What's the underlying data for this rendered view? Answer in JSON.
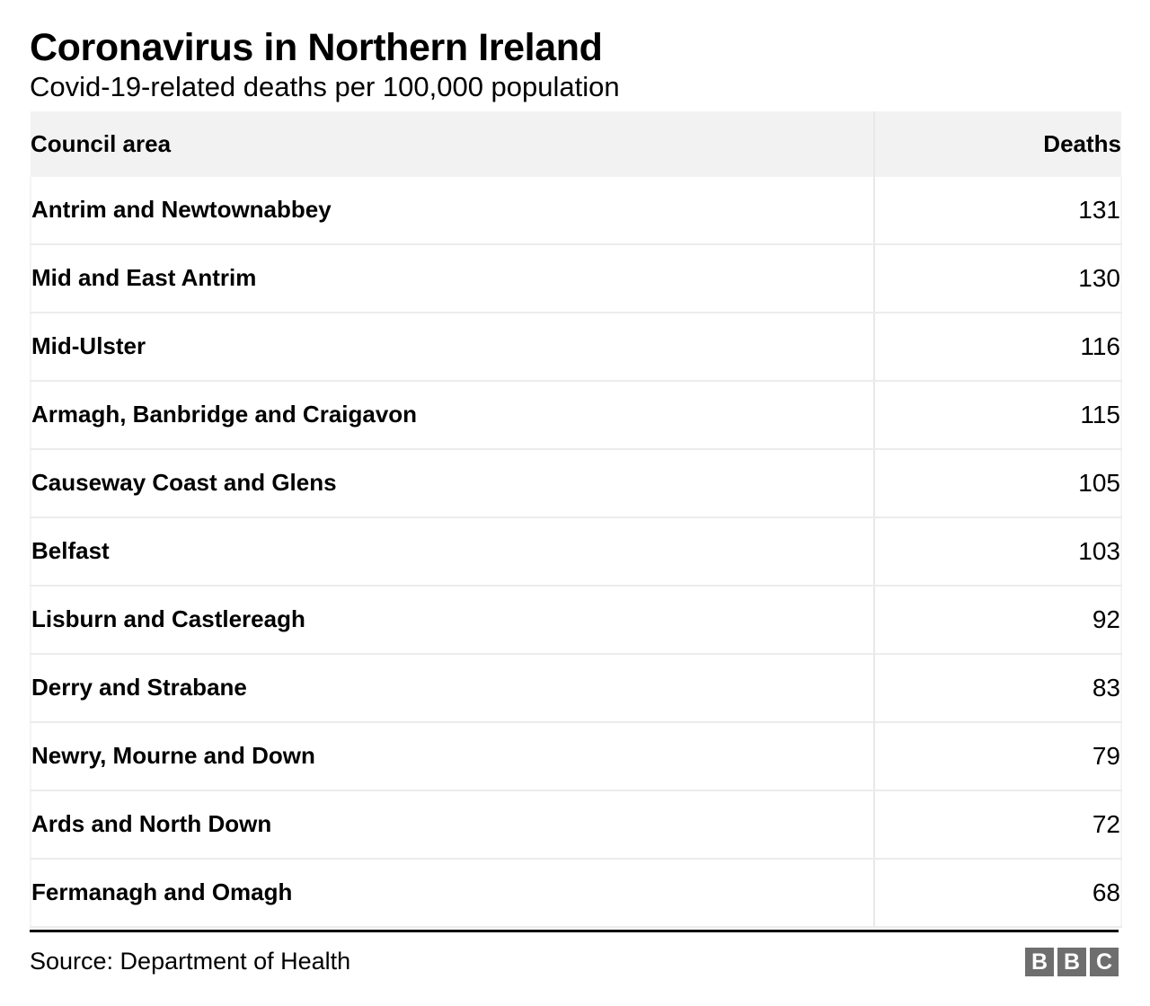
{
  "header": {
    "title": "Coronavirus in Northern Ireland",
    "subtitle": "Covid-19-related deaths per 100,000 population"
  },
  "table": {
    "columns": [
      "Council area",
      "Deaths"
    ],
    "rows": [
      {
        "area": "Antrim and Newtownabbey",
        "deaths": "131"
      },
      {
        "area": "Mid and East Antrim",
        "deaths": "130"
      },
      {
        "area": "Mid-Ulster",
        "deaths": "116"
      },
      {
        "area": "Armagh, Banbridge and Craigavon",
        "deaths": "115"
      },
      {
        "area": "Causeway Coast and Glens",
        "deaths": "105"
      },
      {
        "area": "Belfast",
        "deaths": "103"
      },
      {
        "area": "Lisburn and Castlereagh",
        "deaths": "92"
      },
      {
        "area": "Derry and Strabane",
        "deaths": "83"
      },
      {
        "area": "Newry, Mourne and Down",
        "deaths": "79"
      },
      {
        "area": "Ards and North Down",
        "deaths": "72"
      },
      {
        "area": "Fermanagh and Omagh",
        "deaths": "68"
      }
    ]
  },
  "footer": {
    "source": "Source: Department of Health",
    "logo_letters": [
      "B",
      "B",
      "C"
    ]
  },
  "colors": {
    "header_row_background": "#f2f2f2",
    "row_separator": "#ececec",
    "footer_rule": "#000000",
    "logo_block": "#6e6e6e",
    "text": "#000000",
    "page_background": "#ffffff"
  },
  "chart_data": {
    "type": "table",
    "title": "Coronavirus in Northern Ireland",
    "subtitle": "Covid-19-related deaths per 100,000 population",
    "columns": [
      "Council area",
      "Deaths"
    ],
    "categories": [
      "Antrim and Newtownabbey",
      "Mid and East Antrim",
      "Mid-Ulster",
      "Armagh, Banbridge and Craigavon",
      "Causeway Coast and Glens",
      "Belfast",
      "Lisburn and Castlereagh",
      "Derry and Strabane",
      "Newry, Mourne and Down",
      "Ards and North Down",
      "Fermanagh and Omagh"
    ],
    "values": [
      131,
      130,
      116,
      115,
      105,
      103,
      92,
      83,
      79,
      72,
      68
    ],
    "xlabel": "Council area",
    "ylabel": "Deaths per 100,000 population",
    "source": "Source: Department of Health"
  }
}
